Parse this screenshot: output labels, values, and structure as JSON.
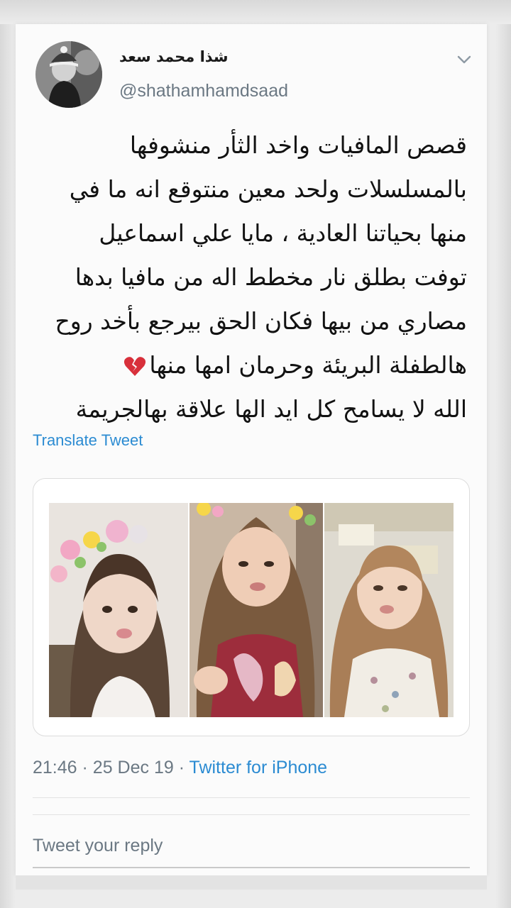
{
  "tweet": {
    "display_name": "شذا محمد سعد",
    "handle": "@shathamhamdsaad",
    "text_lines": [
      "قصص المافيات واخد الثأر منشوفها",
      "بالمسلسلات ولحد معين منتوقع انه ما في",
      "منها بحياتنا العادية ، مايا علي اسماعيل",
      "توفت بطلق نار مخطط اله من مافيا بدها",
      "مصاري من بيها فكان الحق بيرجع بأخد روح",
      "هالطفلة البريئة وحرمان امها منها",
      "الله لا يسامح كل ايد الها علاقة بهالجريمة"
    ],
    "emoji": "broken-heart",
    "translate_label": "Translate Tweet",
    "time": "21:46",
    "date": "25 Dec 19",
    "source": "Twitter for iPhone",
    "separator": "·"
  },
  "reply": {
    "placeholder": "Tweet your reply"
  },
  "media": {
    "count": 3
  },
  "colors": {
    "link": "#2b8bd2",
    "muted": "#6b7883",
    "heart": "#d8303b"
  },
  "icons": {
    "menu": "chevron-down-icon",
    "emoji": "broken-heart-icon"
  }
}
